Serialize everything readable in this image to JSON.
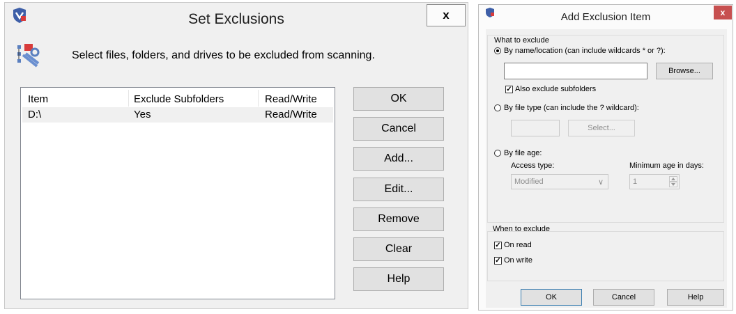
{
  "set_exclusions": {
    "title": "Set Exclusions",
    "close": "x",
    "instruction": "Select files, folders, and drives to be excluded from scanning.",
    "columns": [
      "Item",
      "Exclude Subfolders",
      "Read/Write"
    ],
    "rows": [
      {
        "item": "D:\\",
        "exclude_subfolders": "Yes",
        "read_write": "Read/Write"
      }
    ],
    "buttons": {
      "ok": "OK",
      "cancel": "Cancel",
      "add": "Add...",
      "edit": "Edit...",
      "remove": "Remove",
      "clear": "Clear",
      "help": "Help"
    }
  },
  "add_exclusion_item": {
    "title": "Add Exclusion Item",
    "close": "x",
    "what_to_exclude": {
      "label": "What to exclude",
      "by_name_label": "By name/location (can include wildcards * or ?):",
      "by_name_value": "",
      "browse": "Browse...",
      "also_exclude_subfolders": "Also exclude subfolders",
      "also_exclude_subfolders_checked": true,
      "by_type_label": "By file type (can include the ? wildcard):",
      "by_type_value": "",
      "select": "Select...",
      "by_age_label": "By file age:",
      "access_type_label": "Access type:",
      "access_type_value": "Modified",
      "min_age_label": "Minimum age in days:",
      "min_age_value": "1",
      "selected_option": "by_name"
    },
    "when_to_exclude": {
      "label": "When to exclude",
      "on_read": "On read",
      "on_read_checked": true,
      "on_write": "On write",
      "on_write_checked": true
    },
    "buttons": {
      "ok": "OK",
      "cancel": "Cancel",
      "help": "Help"
    }
  },
  "icons": {
    "app_shield": "shield-icon",
    "exclusions_tool": "exclusion-tool-icon",
    "checkmark": "✓",
    "dropdown": "∨"
  },
  "colors": {
    "close_red": "#c75050",
    "list_border": "#828790"
  }
}
